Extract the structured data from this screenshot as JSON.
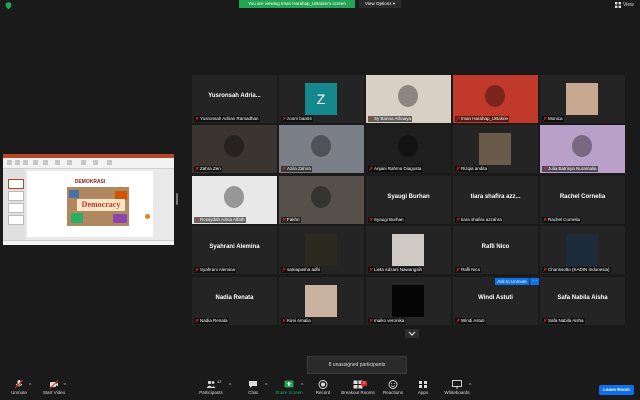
{
  "banner": "You are viewing Iman Harahap_UBakrie's screen",
  "view_options": "View Options",
  "view_label": "View",
  "slide_title": "DEMOKRASI",
  "slide_word": "Democracy",
  "ask_unmute": "Ask to Unmute",
  "more_glyph": "···",
  "unassigned": "8 unassigned participants",
  "tiles": [
    {
      "name": "Yusronsah Adrian Ramadhan",
      "big": "Yusronsah Adria...",
      "photo": null
    },
    {
      "name": "zoom baa04",
      "big": "",
      "photo": "z",
      "photo_color": "#15888d"
    },
    {
      "name": "Sy Banna Athaaya",
      "big": "",
      "photo": "img",
      "photo_color": "#d8d0c4"
    },
    {
      "name": "Iman Harahap_UBakrie",
      "big": "",
      "photo": "img",
      "photo_color": "#c0392b",
      "highlight": true
    },
    {
      "name": "Monica",
      "big": "",
      "photo": "img",
      "photo_color": "#c7a890"
    },
    {
      "name": "Zahra Zen",
      "big": "",
      "photo": "img",
      "photo_color": "#3a3530"
    },
    {
      "name": "Azila Zahira",
      "big": "",
      "photo": "img",
      "photo_color": "#7a7f88"
    },
    {
      "name": "Anjani Rahma Diagosta",
      "big": "",
      "photo": "img",
      "photo_color": "#1e1e1e"
    },
    {
      "name": "Rizqia andita",
      "big": "",
      "photo": "img",
      "photo_color": "#6a5a4a"
    },
    {
      "name": "Julia Batrisya Nuramalia",
      "big": "",
      "photo": "img",
      "photo_color": "#b8a0c8"
    },
    {
      "name": "Rossydah Azkia Alfath",
      "big": "",
      "photo": "img",
      "photo_color": "#e8e8e8"
    },
    {
      "name": "Fakhri",
      "big": "",
      "photo": "img",
      "photo_color": "#55504a"
    },
    {
      "name": "Syaugi Burhan",
      "big": "Syaugi Burhan",
      "photo": null
    },
    {
      "name": "tiara shafira azzahra",
      "big": "tiara shafira azz...",
      "photo": null
    },
    {
      "name": "Rachel Cornelia",
      "big": "Rachel Cornelia",
      "photo": null
    },
    {
      "name": "Syahrani Alemina",
      "big": "Syahrani Alemina",
      "photo": null
    },
    {
      "name": "satriapasha adhi",
      "big": "",
      "photo": "img",
      "photo_color": "#2a2a1e"
    },
    {
      "name": "Lieta Adzani Nawangsih",
      "big": "",
      "photo": "img",
      "photo_color": "#cfcac3"
    },
    {
      "name": "Rafli Nico",
      "big": "Rafli Nico",
      "photo": null
    },
    {
      "name": "Charissotto (KADIN Indonesia)",
      "big": "",
      "photo": "img",
      "photo_color": "#1c2a3a"
    },
    {
      "name": "Nadia Renata",
      "big": "Nadia Renata",
      "photo": null
    },
    {
      "name": "Kirei Amalia",
      "big": "",
      "photo": "img",
      "photo_color": "#c9b2a0"
    },
    {
      "name": "maiko veronika",
      "big": "",
      "photo": "img",
      "photo_color": "#050505"
    },
    {
      "name": "Windi Astuti",
      "big": "Windi Astuti",
      "photo": null
    },
    {
      "name": "Safa Nabila Aisha",
      "big": "Safa Nabila Aisha",
      "photo": null
    }
  ],
  "toolbar": {
    "unmute": "Unmute",
    "start_video": "Start Video",
    "participants": "Participants",
    "participant_count": "42",
    "chat": "Chat",
    "share_screen": "Share Screen",
    "record": "Record",
    "breakout_rooms": "Breakout Rooms",
    "breakout_badge": "1",
    "reactions": "Reactions",
    "apps": "Apps",
    "whiteboards": "Whiteboards",
    "leave": "Leave Room"
  },
  "colors": {
    "accent": "#0e71eb",
    "banner": "#23a455",
    "share_green": "#23a455",
    "mute_red": "#e02828"
  }
}
